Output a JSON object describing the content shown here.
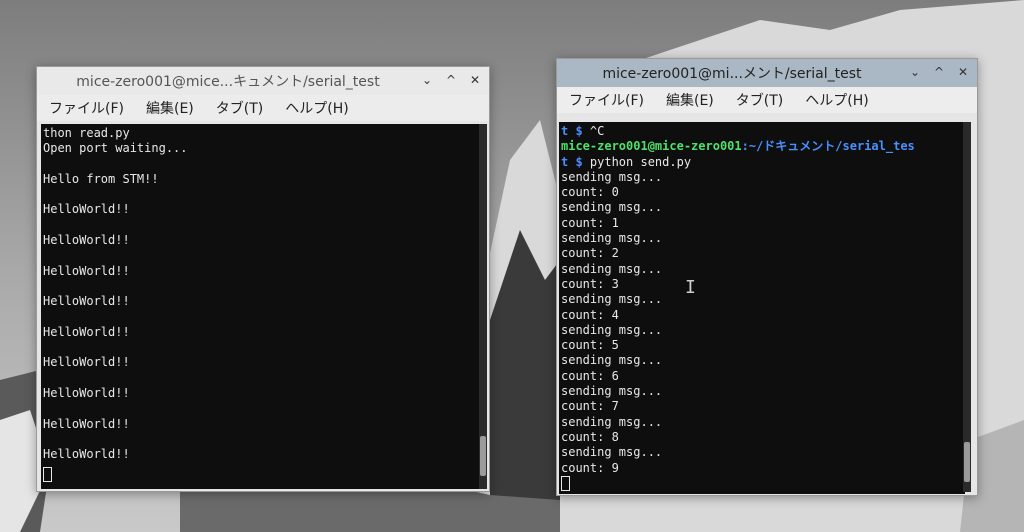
{
  "left_window": {
    "title": "mice-zero001@mice...キュメント/serial_test",
    "controls": {
      "minimize": "⌄",
      "maximize": "^",
      "close": "✕"
    },
    "menu": [
      "ファイル(F)",
      "編集(E)",
      "タブ(T)",
      "ヘルプ(H)"
    ],
    "lines": [
      "thon read.py",
      "Open port waiting...",
      "",
      "Hello from STM!!",
      "",
      "HelloWorld!!",
      "",
      "HelloWorld!!",
      "",
      "HelloWorld!!",
      "",
      "HelloWorld!!",
      "",
      "HelloWorld!!",
      "",
      "HelloWorld!!",
      "",
      "HelloWorld!!",
      "",
      "HelloWorld!!",
      "",
      "HelloWorld!!"
    ]
  },
  "right_window": {
    "title": "mice-zero001@mi...メント/serial_test",
    "controls": {
      "minimize": "⌄",
      "maximize": "^",
      "close": "✕"
    },
    "menu": [
      "ファイル(F)",
      "編集(E)",
      "タブ(T)",
      "ヘルプ(H)"
    ],
    "prompt1": {
      "sym": "t $ ",
      "cmd": "^C"
    },
    "prompt2": {
      "user": "mice-zero001@mice-zero001",
      "path": ":~/ドキュメント/serial_tes"
    },
    "prompt3": {
      "sym": "t $ ",
      "cmd": "python send.py"
    },
    "lines": [
      "sending msg...",
      "count: 0",
      "sending msg...",
      "count: 1",
      "sending msg...",
      "count: 2",
      "sending msg...",
      "count: 3",
      "sending msg...",
      "count: 4",
      "sending msg...",
      "count: 5",
      "sending msg...",
      "count: 6",
      "sending msg...",
      "count: 7",
      "sending msg...",
      "count: 8",
      "sending msg...",
      "count: 9"
    ]
  }
}
